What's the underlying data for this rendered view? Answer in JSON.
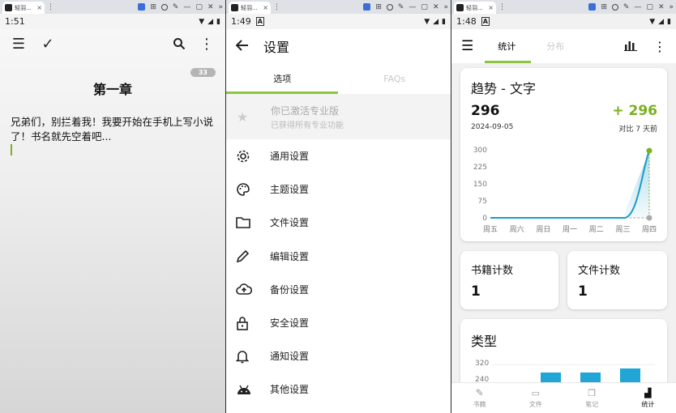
{
  "browser": {
    "tab_title": "轻羽...",
    "close_glyph": "×",
    "menu_glyph": "⋮",
    "ctrl_glyphs": [
      "—",
      "▢",
      "✕",
      "»"
    ]
  },
  "pane1": {
    "status_time": "1:51",
    "chapter_badge": "33",
    "chapter_title": "第一章",
    "text": "兄弟们，别拦着我！我要开始在手机上写小说了！书名就先空着吧..."
  },
  "pane2": {
    "status_time": "1:49",
    "title": "设置",
    "tabs": [
      "选项",
      "FAQs"
    ],
    "pro_title": "你已激活专业版",
    "pro_sub": "已获得所有专业功能",
    "items": [
      "通用设置",
      "主题设置",
      "文件设置",
      "编辑设置",
      "备份设置",
      "安全设置",
      "通知设置",
      "其他设置"
    ]
  },
  "pane3": {
    "status_time": "1:48",
    "tabs": [
      "统计",
      "分布"
    ],
    "trend_title": "趋势 - 文字",
    "total": "296",
    "date": "2024-09-05",
    "delta": "+ 296",
    "delta_note": "对比 7 天前",
    "book_count_label": "书籍计数",
    "book_count": "1",
    "file_count_label": "文件计数",
    "file_count": "1",
    "type_title": "类型",
    "type_ticks": [
      "320",
      "240"
    ],
    "nav": [
      "书籍",
      "文件",
      "笔记",
      "统计"
    ]
  },
  "chart_data": {
    "type": "line",
    "categories": [
      "周五",
      "周六",
      "周日",
      "周一",
      "周二",
      "周三",
      "周四"
    ],
    "values": [
      0,
      0,
      0,
      0,
      0,
      0,
      296
    ],
    "yticks": [
      0,
      75,
      150,
      225,
      300
    ],
    "ylim": [
      0,
      300
    ],
    "color": "#1a9bc8",
    "marker_color": "#7ab021"
  }
}
